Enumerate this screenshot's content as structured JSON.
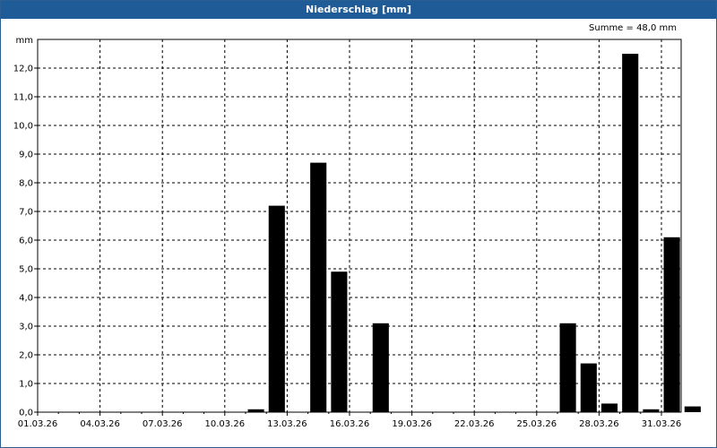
{
  "window": {
    "title": "Niederschlag [mm]"
  },
  "summary": {
    "text": "Summe = 48,0 mm"
  },
  "chart_data": {
    "type": "bar",
    "title": "Niederschlag [mm]",
    "ylabel": "mm",
    "xlabel": "",
    "ylim": [
      0,
      13
    ],
    "grid": true,
    "y_ticks": [
      "0,0",
      "1,0",
      "2,0",
      "3,0",
      "4,0",
      "5,0",
      "6,0",
      "7,0",
      "8,0",
      "9,0",
      "10,0",
      "11,0",
      "12,0"
    ],
    "x_ticks": [
      "01.03.26",
      "04.03.26",
      "07.03.26",
      "10.03.26",
      "13.03.26",
      "16.03.26",
      "19.03.26",
      "22.03.26",
      "25.03.26",
      "28.03.26",
      "31.03.26"
    ],
    "categories": [
      "01.03.26",
      "02.03.26",
      "03.03.26",
      "04.03.26",
      "05.03.26",
      "06.03.26",
      "07.03.26",
      "08.03.26",
      "09.03.26",
      "10.03.26",
      "11.03.26",
      "12.03.26",
      "13.03.26",
      "14.03.26",
      "15.03.26",
      "16.03.26",
      "17.03.26",
      "18.03.26",
      "19.03.26",
      "20.03.26",
      "21.03.26",
      "22.03.26",
      "23.03.26",
      "24.03.26",
      "25.03.26",
      "26.03.26",
      "27.03.26",
      "28.03.26",
      "29.03.26",
      "30.03.26",
      "31.03.26"
    ],
    "values": [
      0,
      0,
      0,
      0,
      0,
      0,
      0,
      0,
      0,
      0,
      0.1,
      7.2,
      0,
      8.7,
      4.9,
      0,
      3.1,
      0,
      0,
      0,
      0,
      0,
      0,
      0,
      0,
      3.1,
      1.7,
      0.3,
      12.5,
      0.1,
      6.1,
      0.2
    ],
    "bar_color": "#000000",
    "sum": "48,0 mm"
  }
}
